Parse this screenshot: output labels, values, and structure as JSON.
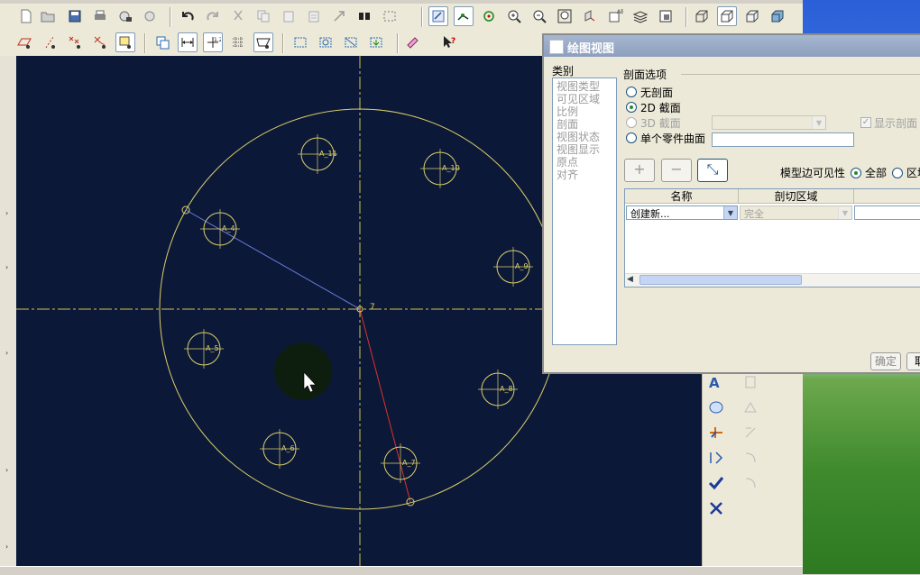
{
  "toolbar": {
    "row1_icons": [
      "new-file-icon",
      "open-folder-icon",
      "save-icon",
      "print-icon",
      "lock-file-icon",
      "erase-icon",
      "undo-icon",
      "redo-icon",
      "cut-icon",
      "copy-icon",
      "paste-icon",
      "paste-special-icon",
      "regenerate-icon",
      "find-icon",
      "select-box-icon",
      "repaint-icon",
      "datum-display-icon",
      "spin-center-icon",
      "zoom-in-icon",
      "zoom-out-icon",
      "refit-icon",
      "orient-icon",
      "named-view-icon",
      "layers-icon",
      "view-manager-icon",
      "wireframe-icon",
      "hidden-line-icon",
      "no-hidden-icon",
      "shading-icon"
    ],
    "row2_icons": [
      "datum-plane-display-icon",
      "datum-axis-display-icon",
      "point-display-icon",
      "csys-display-icon",
      "annotation-display-icon",
      "refresh-sheet-icon",
      "dimension-icon",
      "ordinate-dimension-icon",
      "table-icon",
      "note-icon",
      "show-annotations-icon",
      "detail-item-icon",
      "snap-icon",
      "move-view-icon",
      "format-icon",
      "context-help-icon"
    ]
  },
  "drawing": {
    "holes": [
      {
        "label": "A_11"
      },
      {
        "label": "A_10"
      },
      {
        "label": "A_4"
      },
      {
        "label": "A_9"
      },
      {
        "label": "A_5"
      },
      {
        "label": "A_8"
      },
      {
        "label": "A_6"
      },
      {
        "label": "A_7"
      }
    ],
    "center_label": "7",
    "colors": {
      "background": "#0b1838",
      "geometry": "#ddd06a",
      "centerline": "#d4c24a",
      "blue_line": "#6a7de0",
      "red_line": "#e03030"
    }
  },
  "dialog": {
    "title": "绘图视图",
    "category_label": "类别",
    "categories": [
      "视图类型",
      "可见区域",
      "比例",
      "剖面",
      "视图状态",
      "视图显示",
      "原点",
      "对齐"
    ],
    "section_options_label": "剖面选项",
    "radio_no_section": "无剖面",
    "radio_2d": "2D 截面",
    "radio_3d": "3D 截面",
    "radio_single_surface": "单个零件曲面",
    "show_section_checkbox": "显示剖面",
    "model_edge_visibility_label": "模型边可见性",
    "radio_all": "全部",
    "radio_area": "区域",
    "table_headers": [
      "名称",
      "剖切区域"
    ],
    "row_name_value": "创建新...",
    "row_area_value": "完全",
    "ok_button": "确定",
    "cancel_button": "取"
  },
  "right_panel": {
    "icons": [
      "note-icon",
      "balloon-icon",
      "symbol-icon",
      "datum-target-icon",
      "accept-icon",
      "cancel-icon"
    ]
  }
}
